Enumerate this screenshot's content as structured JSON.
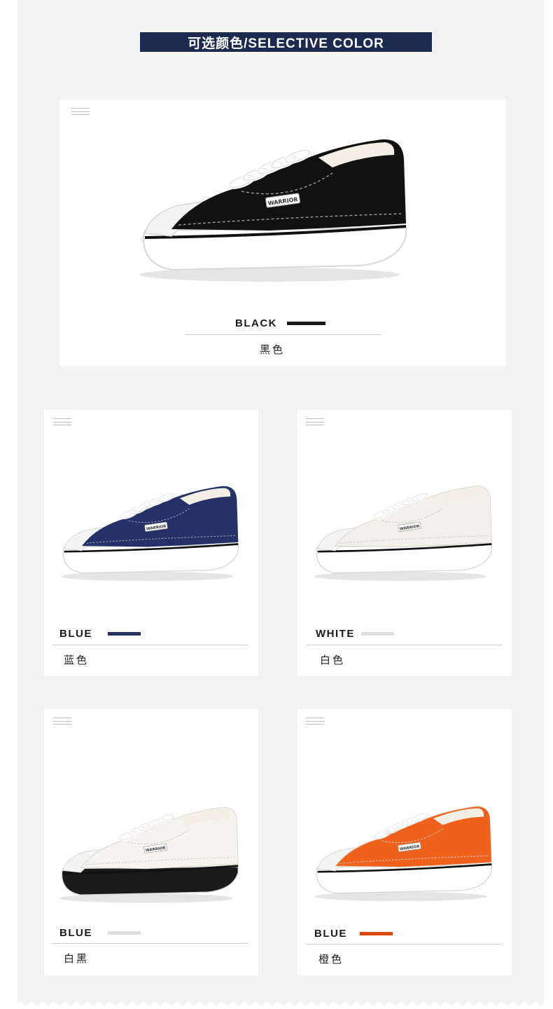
{
  "header": {
    "title": "可选颜色/SELECTIVE COLOR"
  },
  "colors": {
    "navy": "#1b2a4e",
    "blue_swatch": "#25335c",
    "white_swatch": "#e0e0e0",
    "orange_swatch": "#d9460f",
    "black_swatch": "#1a1a1a"
  },
  "products": [
    {
      "label_en": "BLACK",
      "label_cn": "黑色",
      "upper": "#111111",
      "sole_stripe": "#111111",
      "sole": "#ffffff",
      "swatch": "#1a1a1a"
    },
    {
      "label_en": "BLUE",
      "label_cn": "蓝色",
      "upper": "#243269",
      "sole_stripe": "#111111",
      "sole": "#ffffff",
      "swatch": "#25335c"
    },
    {
      "label_en": "WHITE",
      "label_cn": "白色",
      "upper": "#f2f0ea",
      "sole_stripe": "#111111",
      "sole": "#ffffff",
      "swatch": "#e0e0e0"
    },
    {
      "label_en": "BLUE",
      "label_cn": "白黑",
      "upper": "#f4f3ee",
      "sole_stripe": "#111111",
      "sole": "#1a1a1a",
      "swatch": "#e0e0e0"
    },
    {
      "label_en": "BLUE",
      "label_cn": "橙色",
      "upper": "#f0621c",
      "sole_stripe": "#111111",
      "sole": "#ffffff",
      "swatch": "#d9460f"
    }
  ],
  "brand_tag": "WARRIOR"
}
